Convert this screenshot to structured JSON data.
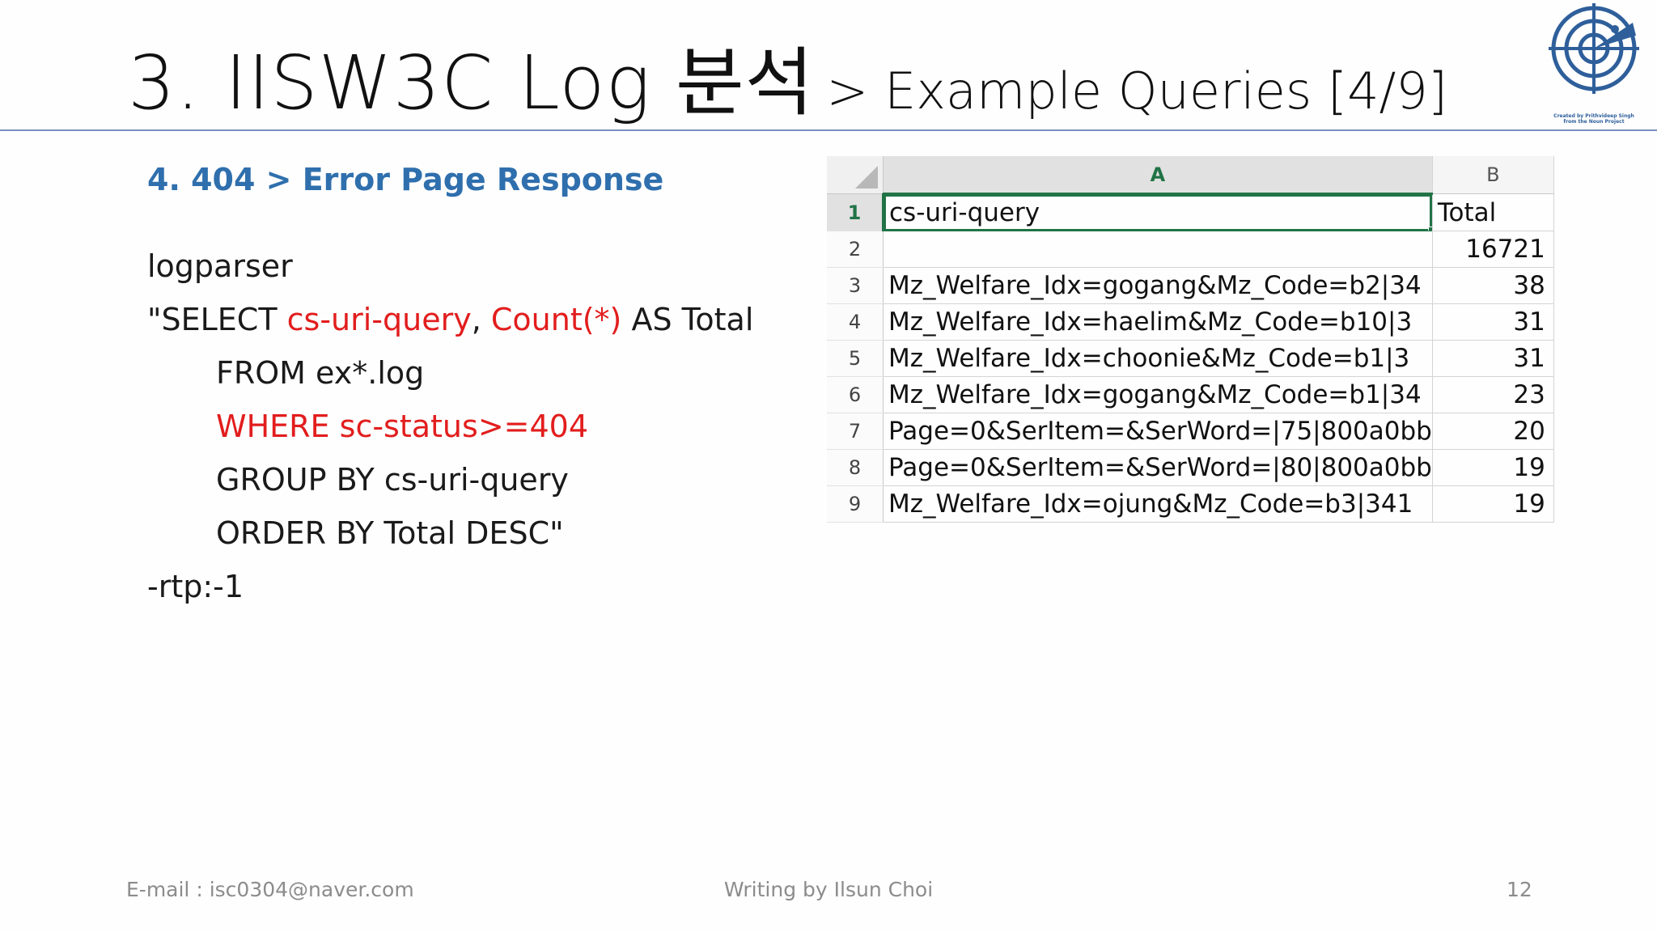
{
  "title": {
    "main": "3. IISW3C Log 분석",
    "sub": "> Example Queries [4/9]"
  },
  "logo": {
    "icon": "radar-target-icon",
    "caption_line1": "Created by Prithvideep Singh",
    "caption_line2": "from the Noun Project",
    "color": "#2e5f9b"
  },
  "subheading": "4. 404 > Error Page Response",
  "query": {
    "line1": "logparser",
    "line2_prefix": "\"SELECT ",
    "line2_field": "cs-uri-query",
    "line2_comma": ", ",
    "line2_count": "Count(*)",
    "line2_suffix": " AS Total",
    "line3": "FROM ex*.log",
    "line4": "WHERE sc-status>=404",
    "line5": "GROUP BY cs-uri-query",
    "line6": "ORDER BY Total DESC\"",
    "line7": "-rtp:-1",
    "highlight_color": "#e21d1d"
  },
  "spreadsheet": {
    "columns": [
      "A",
      "B"
    ],
    "rows": [
      {
        "num": "1",
        "a": "cs-uri-query",
        "b": "Total"
      },
      {
        "num": "2",
        "a": "",
        "b": "16721"
      },
      {
        "num": "3",
        "a": "Mz_Welfare_Idx=gogang&Mz_Code=b2|34",
        "b": "38"
      },
      {
        "num": "4",
        "a": "Mz_Welfare_Idx=haelim&Mz_Code=b10|3",
        "b": "31"
      },
      {
        "num": "5",
        "a": "Mz_Welfare_Idx=choonie&Mz_Code=b1|3",
        "b": "31"
      },
      {
        "num": "6",
        "a": "Mz_Welfare_Idx=gogang&Mz_Code=b1|34",
        "b": "23"
      },
      {
        "num": "7",
        "a": "Page=0&SerItem=&SerWord=|75|800a0bb",
        "b": "20"
      },
      {
        "num": "8",
        "a": "Page=0&SerItem=&SerWord=|80|800a0bb",
        "b": "19"
      },
      {
        "num": "9",
        "a": "Mz_Welfare_Idx=ojung&Mz_Code=b3|341",
        "b": "19"
      }
    ],
    "accent_color": "#217346"
  },
  "footer": {
    "email": "E-mail : isc0304@naver.com",
    "author": "Writing by Ilsun Choi",
    "page": "12"
  },
  "heading_color": "#2f6fad"
}
